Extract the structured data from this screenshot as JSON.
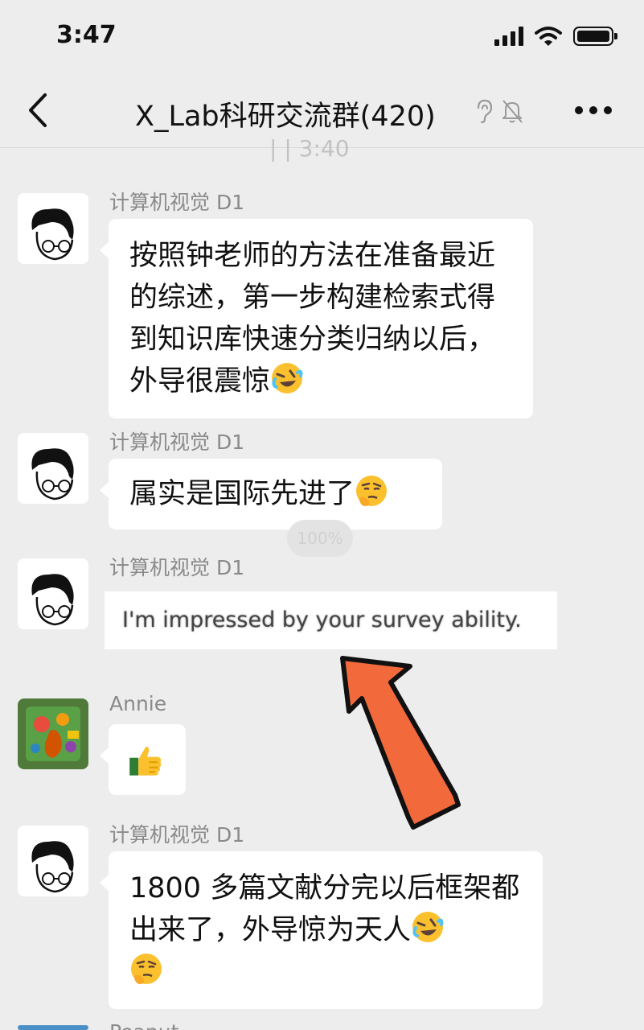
{
  "status_bar": {
    "time": "3:47"
  },
  "nav": {
    "title": "X_Lab科研交流群(420)"
  },
  "ghost_timestamp": "| | 3:40",
  "zoom_indicator": "100%",
  "messages": [
    {
      "sender": "计算机视觉 D1",
      "text": "按照钟老师的方法在准备最近的综述，第一步构建检索式得到知识库快速分类归纳以后，外导很震惊",
      "emoji": "rolling-on-floor-laughing-emoji"
    },
    {
      "sender": "计算机视觉 D1",
      "text": "属实是国际先进了",
      "emoji": "monocle-face-emoji"
    },
    {
      "sender": "计算机视觉 D1",
      "image_text": "I'm impressed by your survey ability."
    },
    {
      "sender": "Annie",
      "emoji": "thumbs-up-emoji"
    },
    {
      "sender": "计算机视觉 D1",
      "text": "1800 多篇文献分完以后框架都出来了，外导惊为天人",
      "emoji": "rolling-on-floor-laughing-emoji",
      "emoji2": "monocle-face-emoji"
    },
    {
      "sender": "Peanut"
    }
  ],
  "colors": {
    "background": "#ededed",
    "bubble": "#ffffff",
    "arrow": "#f26a3c"
  }
}
